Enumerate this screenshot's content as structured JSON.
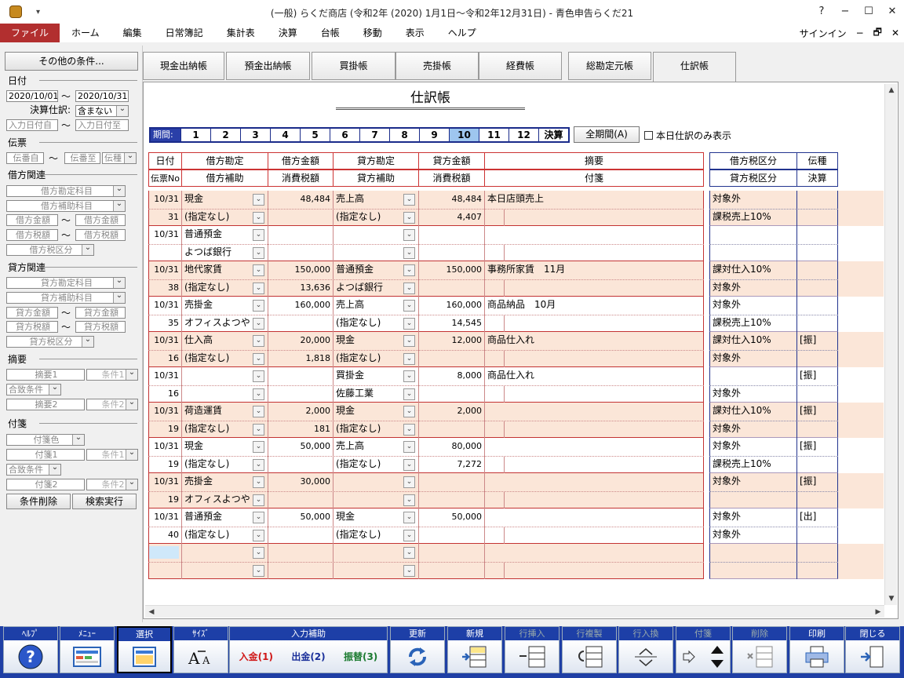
{
  "window": {
    "title": "(一般) らくだ商店 (令和2年 (2020) 1月1日～令和2年12月31日) - 青色申告らくだ21",
    "help": "?",
    "min": "−",
    "max": "☐",
    "close": "✕",
    "qa": "▾"
  },
  "menu": {
    "items": [
      "ファイル",
      "ホーム",
      "編集",
      "日常簿記",
      "集計表",
      "決算",
      "台帳",
      "移動",
      "表示",
      "ヘルプ"
    ],
    "signin": "サインイン",
    "ctrl": [
      "−",
      "🗗",
      "✕"
    ]
  },
  "left": {
    "other_btn": "その他の条件...",
    "date_sec": "日付",
    "date_from": "2020/10/01",
    "date_to": "2020/10/31",
    "tilde": "～",
    "kessan_label": "決算仕訳:",
    "kessan_val": "含まない",
    "input_from": "入力日付自",
    "input_to": "入力日付至",
    "den_sec": "伝票",
    "den_from": "伝番自",
    "den_to": "伝番至",
    "den_type": "伝種",
    "kari_sec": "借方関連",
    "kari_acct": "借方勘定科目",
    "kari_sub": "借方補助科目",
    "kari_amt1": "借方金額",
    "kari_amt2": "借方金額",
    "kari_tax1": "借方税額",
    "kari_tax2": "借方税額",
    "kari_taxcls": "借方税区分",
    "kashi_sec": "貸方関連",
    "kashi_acct": "貸方勘定科目",
    "kashi_sub": "貸方補助科目",
    "kashi_amt1": "貸方金額",
    "kashi_amt2": "貸方金額",
    "kashi_tax1": "貸方税額",
    "kashi_tax2": "貸方税額",
    "kashi_taxcls": "貸方税区分",
    "tekiyo_sec": "摘要",
    "tekiyo1": "摘要1",
    "cond1": "条件1",
    "match": "合致条件",
    "tekiyo2": "摘要2",
    "cond2": "条件2",
    "fusen_sec": "付箋",
    "fusen_color": "付箋色",
    "fusen1": "付箋1",
    "fcond1": "条件1",
    "fmatch": "合致条件",
    "fusen2": "付箋2",
    "fcond2": "条件2",
    "clear_btn": "条件削除",
    "search_btn": "検索実行"
  },
  "tabs": [
    "現金出納帳",
    "預金出納帳",
    "買掛帳",
    "売掛帳",
    "経費帳",
    "総勘定元帳",
    "仕訳帳"
  ],
  "page_title": "仕訳帳",
  "period": {
    "label": "期間:",
    "items": [
      "1",
      "2",
      "3",
      "4",
      "5",
      "6",
      "7",
      "8",
      "9",
      "10",
      "11",
      "12",
      "決算"
    ],
    "selected": "10"
  },
  "all_period": "全期間(A)",
  "today_only": "本日仕訳のみ表示",
  "headers": {
    "date": "日付",
    "den_no": "伝票No",
    "kari": "借方勘定",
    "kari_sub": "借方補助",
    "kari_amt": "借方金額",
    "kari_tax": "消費税額",
    "kashi": "貸方勘定",
    "kashi_sub": "貸方補助",
    "kashi_amt": "貸方金額",
    "kashi_tax": "消費税額",
    "tekiyo": "摘要",
    "fusen": "付箋",
    "kari_taxcls": "借方税区分",
    "kashi_taxcls": "貸方税区分",
    "den_type": "伝種",
    "kessan": "決算"
  },
  "entries": [
    {
      "date": "10/31",
      "no": "31",
      "kari": "現金",
      "kari_sub": "(指定なし)",
      "kari_amt": "48,484",
      "kari_tax": "",
      "kashi": "売上高",
      "kashi_sub": "(指定なし)",
      "kashi_amt": "48,484",
      "kashi_tax": "4,407",
      "tekiyo": "本日店頭売上",
      "tc1": "対象外",
      "tc2": "課税売上10%",
      "type": "",
      "shade": true
    },
    {
      "date": "10/31",
      "no": "",
      "kari": "普通預金",
      "kari_sub": "よつば銀行",
      "kari_amt": "",
      "kari_tax": "",
      "kashi": "",
      "kashi_sub": "",
      "kashi_amt": "",
      "kashi_tax": "",
      "tekiyo": "",
      "tc1": "",
      "tc2": "",
      "type": "",
      "shade": false
    },
    {
      "date": "10/31",
      "no": "38",
      "kari": "地代家賃",
      "kari_sub": "(指定なし)",
      "kari_amt": "150,000",
      "kari_tax": "13,636",
      "kashi": "普通預金",
      "kashi_sub": "よつば銀行",
      "kashi_amt": "150,000",
      "kashi_tax": "",
      "tekiyo": "事務所家賃　11月",
      "tc1": "課対仕入10%",
      "tc2": "対象外",
      "type": "",
      "shade": true
    },
    {
      "date": "10/31",
      "no": "35",
      "kari": "売掛金",
      "kari_sub": "オフィスよつや",
      "kari_amt": "160,000",
      "kari_tax": "",
      "kashi": "売上高",
      "kashi_sub": "(指定なし)",
      "kashi_amt": "160,000",
      "kashi_tax": "14,545",
      "tekiyo": "商品納品　10月",
      "tc1": "対象外",
      "tc2": "課税売上10%",
      "type": "",
      "shade": false
    },
    {
      "date": "10/31",
      "no": "16",
      "kari": "仕入高",
      "kari_sub": "(指定なし)",
      "kari_amt": "20,000",
      "kari_tax": "1,818",
      "kashi": "現金",
      "kashi_sub": "(指定なし)",
      "kashi_amt": "12,000",
      "kashi_tax": "",
      "tekiyo": "商品仕入れ",
      "tc1": "課対仕入10%",
      "tc2": "対象外",
      "type": "[振]",
      "shade": true
    },
    {
      "date": "10/31",
      "no": "16",
      "kari": "",
      "kari_sub": "",
      "kari_amt": "",
      "kari_tax": "",
      "kashi": "買掛金",
      "kashi_sub": "佐藤工業",
      "kashi_amt": "8,000",
      "kashi_tax": "",
      "tekiyo": "商品仕入れ",
      "tc1": "",
      "tc2": "対象外",
      "type": "[振]",
      "shade": false
    },
    {
      "date": "10/31",
      "no": "19",
      "kari": "荷造運賃",
      "kari_sub": "(指定なし)",
      "kari_amt": "2,000",
      "kari_tax": "181",
      "kashi": "現金",
      "kashi_sub": "(指定なし)",
      "kashi_amt": "2,000",
      "kashi_tax": "",
      "tekiyo": "",
      "tc1": "課対仕入10%",
      "tc2": "対象外",
      "type": "[振]",
      "shade": true
    },
    {
      "date": "10/31",
      "no": "19",
      "kari": "現金",
      "kari_sub": "(指定なし)",
      "kari_amt": "50,000",
      "kari_tax": "",
      "kashi": "売上高",
      "kashi_sub": "(指定なし)",
      "kashi_amt": "80,000",
      "kashi_tax": "7,272",
      "tekiyo": "",
      "tc1": "対象外",
      "tc2": "課税売上10%",
      "type": "[振]",
      "shade": false
    },
    {
      "date": "10/31",
      "no": "19",
      "kari": "売掛金",
      "kari_sub": "オフィスよつや",
      "kari_amt": "30,000",
      "kari_tax": "",
      "kashi": "",
      "kashi_sub": "",
      "kashi_amt": "",
      "kashi_tax": "",
      "tekiyo": "",
      "tc1": "対象外",
      "tc2": "",
      "type": "[振]",
      "shade": true
    },
    {
      "date": "10/31",
      "no": "40",
      "kari": "普通預金",
      "kari_sub": "(指定なし)",
      "kari_amt": "50,000",
      "kari_tax": "",
      "kashi": "現金",
      "kashi_sub": "(指定なし)",
      "kashi_amt": "50,000",
      "kashi_tax": "",
      "tekiyo": "",
      "tc1": "対象外",
      "tc2": "対象外",
      "type": "[出]",
      "shade": false
    },
    {
      "date": "",
      "no": "",
      "kari": "",
      "kari_sub": "",
      "kari_amt": "",
      "kari_tax": "",
      "kashi": "",
      "kashi_sub": "",
      "kashi_amt": "",
      "kashi_tax": "",
      "tekiyo": "",
      "tc1": "",
      "tc2": "",
      "type": "",
      "shade": true
    }
  ],
  "toolbar": {
    "help": "ﾍﾙﾌﾟ",
    "menu": "ﾒﾆｭｰ",
    "select": "選択",
    "size": "ｻｲｽﾞ",
    "input_assist": "入力補助",
    "nyukin": "入金(1)",
    "shukkin": "出金(2)",
    "furikae": "振替(3)",
    "update": "更新",
    "new": "新規",
    "insert": "行挿入",
    "copy": "行複製",
    "swap": "行入換",
    "fusen": "付箋",
    "delete": "削除",
    "print": "印刷",
    "close": "閉じる"
  },
  "colors": {
    "accent": "#b22f2f",
    "toolbar": "#1f3fa5",
    "shade": "#fbe6d8",
    "grid_red": "#c33333",
    "grid_blue": "#22348f"
  }
}
